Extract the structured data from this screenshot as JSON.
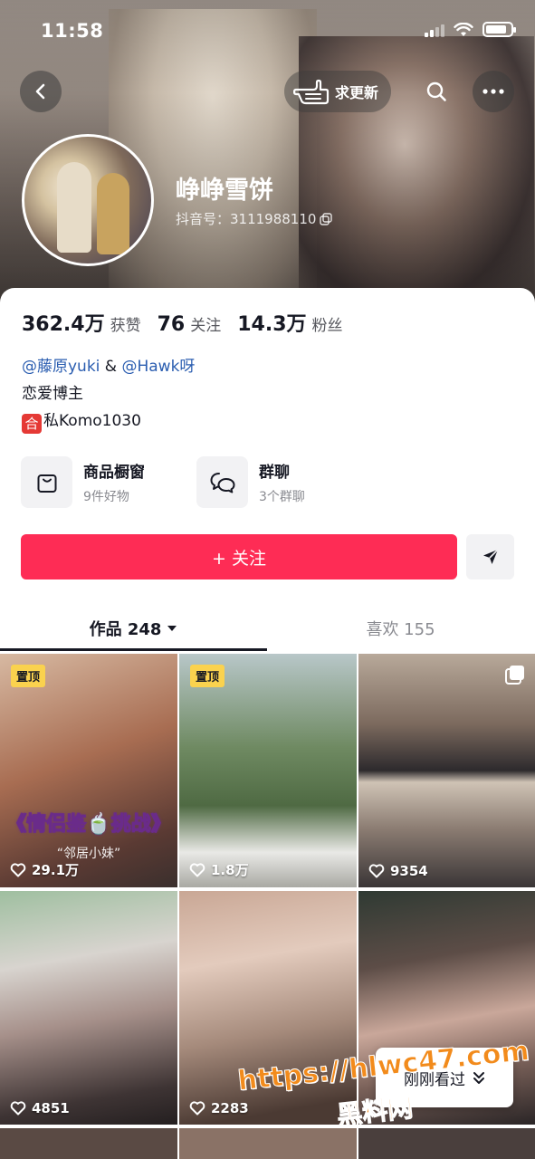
{
  "status_bar": {
    "time": "11:58"
  },
  "header": {
    "update_request_label": "求更新",
    "username": "峥峥雪饼",
    "douyin_id": "抖音号：3111988110"
  },
  "stats": [
    {
      "value": "362.4万",
      "label": "获赞"
    },
    {
      "value": "76",
      "label": "关注"
    },
    {
      "value": "14.3万",
      "label": "粉丝"
    }
  ],
  "bio": {
    "mention1": "@藤原yuki",
    "separator": " & ",
    "mention2": "@Hawk呀",
    "line2": "恋爱博主",
    "badge": "合",
    "line3": "私Komo1030"
  },
  "entries": [
    {
      "title": "商品橱窗",
      "subtitle": "9件好物",
      "icon": "shopping-bag-icon"
    },
    {
      "title": "群聊",
      "subtitle": "3个群聊",
      "icon": "chat-bubbles-icon"
    }
  ],
  "actions": {
    "follow_label": "+ 关注"
  },
  "tabs": [
    {
      "label": "作品 248",
      "active": true
    },
    {
      "label": "喜欢 155",
      "active": false
    }
  ],
  "videos": [
    {
      "pinned": "置顶",
      "likes": "29.1万",
      "caption": "《情侣鉴🍵挑战》",
      "subcaption": "“邻居小妹”"
    },
    {
      "pinned": "置顶",
      "likes": "1.8万"
    },
    {
      "likes": "9354"
    },
    {
      "likes": "4851"
    },
    {
      "likes": "2283"
    },
    {
      "likes": ""
    }
  ],
  "tooltip": {
    "label": "刚刚看过"
  },
  "watermark": {
    "line1": "https://hlwc47.com",
    "line2": "黑料网"
  },
  "colors": {
    "accent": "#fe2c55",
    "pin": "#fad24e",
    "mention": "#2a5db0"
  }
}
